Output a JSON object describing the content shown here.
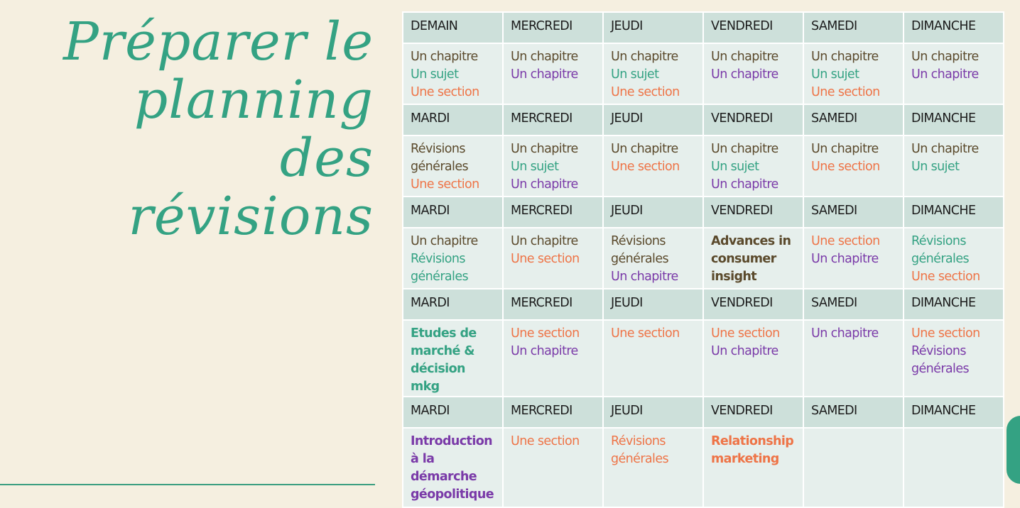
{
  "title": {
    "lines": [
      "Préparer le",
      "planning",
      "des",
      "révisions"
    ]
  },
  "colors": {
    "background": "#f5efe0",
    "accent": "#34a283",
    "header_cell": "#cde0da",
    "body_cell": "#e6efec",
    "brown": "#5b4a2c",
    "teal": "#34a283",
    "orange": "#ee7447",
    "purple": "#7a3aa8"
  },
  "weeks": [
    {
      "days": [
        "DEMAIN",
        "MERCREDI",
        "JEUDI",
        "VENDREDI",
        "SAMEDI",
        "DIMANCHE"
      ],
      "cells": [
        [
          {
            "t": "Un chapitre",
            "c": "brown"
          },
          {
            "t": "Un sujet",
            "c": "teal"
          },
          {
            "t": "Une section",
            "c": "orange"
          }
        ],
        [
          {
            "t": "Un chapitre",
            "c": "brown"
          },
          {
            "t": "Un chapitre",
            "c": "purple"
          }
        ],
        [
          {
            "t": "Un chapitre",
            "c": "brown"
          },
          {
            "t": "Un sujet",
            "c": "teal"
          },
          {
            "t": "Une section",
            "c": "orange"
          }
        ],
        [
          {
            "t": "Un chapitre",
            "c": "brown"
          },
          {
            "t": "Un chapitre",
            "c": "purple"
          }
        ],
        [
          {
            "t": "Un chapitre",
            "c": "brown"
          },
          {
            "t": "Un sujet",
            "c": "teal"
          },
          {
            "t": "Une section",
            "c": "orange"
          }
        ],
        [
          {
            "t": "Un chapitre",
            "c": "brown"
          },
          {
            "t": "Un chapitre",
            "c": "purple"
          }
        ]
      ]
    },
    {
      "days": [
        "MARDI",
        "MERCREDI",
        "JEUDI",
        "VENDREDI",
        "SAMEDI",
        "DIMANCHE"
      ],
      "cells": [
        [
          {
            "t": "Révisions générales",
            "c": "brown"
          },
          {
            "t": "Une section",
            "c": "orange"
          }
        ],
        [
          {
            "t": "Un chapitre",
            "c": "brown"
          },
          {
            "t": "Un sujet",
            "c": "teal"
          },
          {
            "t": "Un chapitre",
            "c": "purple"
          }
        ],
        [
          {
            "t": "Un chapitre",
            "c": "brown"
          },
          {
            "t": "Une section",
            "c": "orange"
          }
        ],
        [
          {
            "t": "Un chapitre",
            "c": "brown"
          },
          {
            "t": "Un sujet",
            "c": "teal"
          },
          {
            "t": "Un chapitre",
            "c": "purple"
          }
        ],
        [
          {
            "t": "Un chapitre",
            "c": "brown"
          },
          {
            "t": "Une section",
            "c": "orange"
          }
        ],
        [
          {
            "t": "Un chapitre",
            "c": "brown"
          },
          {
            "t": "Un sujet",
            "c": "teal"
          }
        ]
      ]
    },
    {
      "days": [
        "MARDI",
        "MERCREDI",
        "JEUDI",
        "VENDREDI",
        "SAMEDI",
        "DIMANCHE"
      ],
      "cells": [
        [
          {
            "t": "Un chapitre",
            "c": "brown"
          },
          {
            "t": "Révisions générales",
            "c": "teal"
          }
        ],
        [
          {
            "t": "Un chapitre",
            "c": "brown"
          },
          {
            "t": "Une section",
            "c": "orange"
          }
        ],
        [
          {
            "t": "Révisions générales",
            "c": "brown"
          },
          {
            "t": "Un chapitre",
            "c": "purple"
          }
        ],
        [
          {
            "t": "Advances in consumer insight",
            "c": "brown",
            "b": true
          }
        ],
        [
          {
            "t": "Une section",
            "c": "orange"
          },
          {
            "t": "Un chapitre",
            "c": "purple"
          }
        ],
        [
          {
            "t": "Révisions générales",
            "c": "teal"
          },
          {
            "t": "Une section",
            "c": "orange"
          }
        ]
      ]
    },
    {
      "days": [
        "MARDI",
        "MERCREDI",
        "JEUDI",
        "VENDREDI",
        "SAMEDI",
        "DIMANCHE"
      ],
      "cells": [
        [
          {
            "t": "Etudes de marché & décision mkg",
            "c": "teal",
            "b": true
          }
        ],
        [
          {
            "t": "Une section",
            "c": "orange"
          },
          {
            "t": "Un chapitre",
            "c": "purple"
          }
        ],
        [
          {
            "t": "Une section",
            "c": "orange"
          }
        ],
        [
          {
            "t": "Une section",
            "c": "orange"
          },
          {
            "t": "Un chapitre",
            "c": "purple"
          }
        ],
        [
          {
            "t": "Un chapitre",
            "c": "purple"
          }
        ],
        [
          {
            "t": "Une section",
            "c": "orange"
          },
          {
            "t": "Révisions générales",
            "c": "purple"
          }
        ]
      ]
    },
    {
      "days": [
        "MARDI",
        "MERCREDI",
        "JEUDI",
        "VENDREDI",
        "SAMEDI",
        "DIMANCHE"
      ],
      "cells": [
        [
          {
            "t": "Introduction à la démarche géopolitique",
            "c": "purple",
            "b": true
          }
        ],
        [
          {
            "t": "Une section",
            "c": "orange"
          }
        ],
        [
          {
            "t": "Révisions générales",
            "c": "orange"
          }
        ],
        [
          {
            "t": "Relationship marketing",
            "c": "orange",
            "b": true
          }
        ],
        [],
        []
      ]
    }
  ]
}
